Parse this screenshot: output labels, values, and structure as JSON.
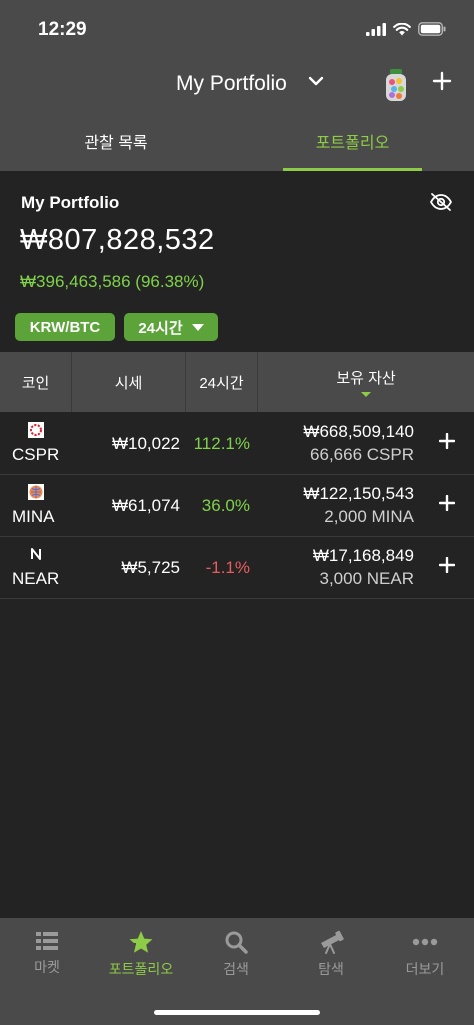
{
  "status_bar": {
    "time": "12:29"
  },
  "header": {
    "title": "My Portfolio"
  },
  "tabs": [
    {
      "label": "관찰 목록",
      "active": false
    },
    {
      "label": "포트폴리오",
      "active": true
    }
  ],
  "summary": {
    "title": "My Portfolio",
    "total_value": "₩807,828,532",
    "profit": "₩396,463,586 (96.38%)",
    "currency_chip": "KRW/BTC",
    "period_chip": "24시간"
  },
  "table": {
    "headers": [
      "코인",
      "시세",
      "24시간",
      "보유 자산"
    ],
    "rows": [
      {
        "symbol": "CSPR",
        "price": "₩10,022",
        "change": "112.1%",
        "direction": "up",
        "holding_value": "₩668,509,140",
        "holding_amount": "66,666 CSPR"
      },
      {
        "symbol": "MINA",
        "price": "₩61,074",
        "change": "36.0%",
        "direction": "up",
        "holding_value": "₩122,150,543",
        "holding_amount": "2,000 MINA"
      },
      {
        "symbol": "NEAR",
        "price": "₩5,725",
        "change": "-1.1%",
        "direction": "down",
        "holding_value": "₩17,168,849",
        "holding_amount": "3,000 NEAR"
      }
    ]
  },
  "bottom_nav": [
    {
      "label": "마켓",
      "icon": "list-icon",
      "active": false
    },
    {
      "label": "포트폴리오",
      "icon": "star-icon",
      "active": true
    },
    {
      "label": "검색",
      "icon": "search-icon",
      "active": false
    },
    {
      "label": "탐색",
      "icon": "telescope-icon",
      "active": false
    },
    {
      "label": "더보기",
      "icon": "more-icon",
      "active": false
    }
  ],
  "colors": {
    "accent": "#8ecb47",
    "positive": "#7fd24a",
    "negative": "#e85c5c",
    "chip": "#5ca33a"
  }
}
